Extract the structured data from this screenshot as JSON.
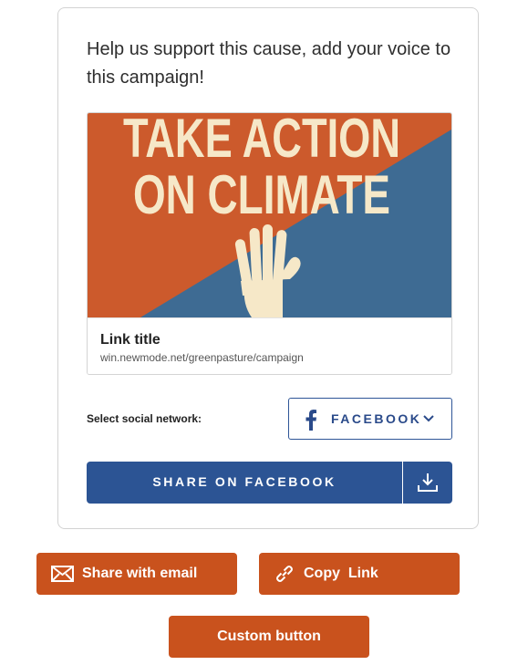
{
  "intro_text": "Help us support this cause, add your voice to this campaign!",
  "preview": {
    "image_text_line1": "TAKE ACTION",
    "image_text_line2": "ON CLIMATE",
    "link_title": "Link title",
    "link_url": "win.newmode.net/greenpasture/campaign"
  },
  "social": {
    "label": "Select social network:",
    "selected": "FACEBOOK",
    "icon": "facebook-icon"
  },
  "share_button": {
    "label": "SHARE ON FACEBOOK",
    "download_icon": "download-icon"
  },
  "email_button": {
    "label": "Share with email",
    "icon": "envelope-icon"
  },
  "copy_button": {
    "label": "Copy  Link",
    "icon": "link-icon"
  },
  "custom_button": {
    "label": "Custom button"
  },
  "colors": {
    "primary_blue": "#2c5494",
    "accent_orange": "#c9521d",
    "poster_orange": "#cc5a2c",
    "poster_blue": "#3e6b93",
    "poster_cream": "#f6e8c8"
  }
}
